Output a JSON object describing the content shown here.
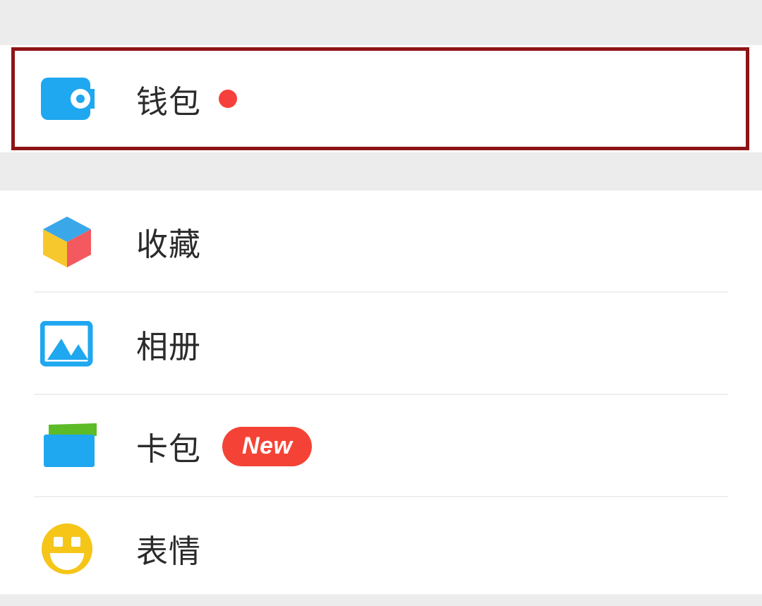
{
  "screen": {
    "app": "WeChat Me Tab",
    "background_color": "#ececec",
    "card_background": "#ffffff"
  },
  "highlight": {
    "color": "#8e1515",
    "target": "wallet-row",
    "border_width_px": 5
  },
  "wallet_section": {
    "items": [
      {
        "id": "wallet",
        "label": "钱包",
        "icon": "wallet-icon",
        "icon_color": "#1fa7f0",
        "badge": {
          "type": "dot",
          "color": "#f6403c",
          "text": ""
        }
      }
    ]
  },
  "list_section": {
    "items": [
      {
        "id": "favorites",
        "label": "收藏",
        "icon": "cube-icon",
        "icon_colors": {
          "top": "#3aa7e8",
          "left": "#f7c82e",
          "right": "#f4595f"
        },
        "badge": null
      },
      {
        "id": "album",
        "label": "相册",
        "icon": "photo-album-icon",
        "icon_color": "#1fa7f0",
        "badge": null
      },
      {
        "id": "cards",
        "label": "卡包",
        "icon": "card-package-icon",
        "icon_colors": {
          "front": "#1fa7f0",
          "back": "#5dbb28"
        },
        "badge": {
          "type": "pill",
          "color": "#f44336",
          "text": "New"
        }
      },
      {
        "id": "stickers",
        "label": "表情",
        "icon": "smiley-face-icon",
        "icon_color": "#f5c518",
        "badge": null
      }
    ]
  }
}
